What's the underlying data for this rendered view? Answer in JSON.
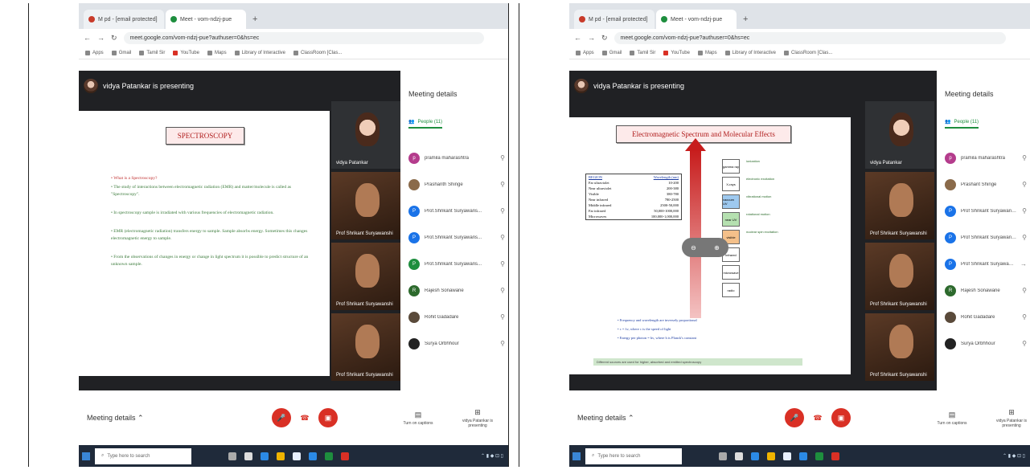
{
  "left": {
    "tabs": [
      "M pd - [email protected]",
      "Meet - vom-ndzj-pue"
    ],
    "url": "meet.google.com/vom-ndzj-pue?authuser=0&hs=ec",
    "bookmarks": [
      "Apps",
      "Gmail",
      "Tamil Sir",
      "YouTube",
      "Maps",
      "Library of Interactive",
      "ClassRoom [Clas..."
    ],
    "presenting": "vidya Patankar is presenting",
    "slide": {
      "title": "SPECTROSCOPY",
      "bullets": [
        "• What is a Spectroscopy?",
        "• The study of interactions between electromagnetic radiation (EMR) and matter/molecule is called as \"Spectroscopy\".",
        "• In spectroscopy sample is irradiated with various frequencies of electromagnetic radiation.",
        "• EMR (electromagnetic radiation) transfers energy to sample. Sample absorbs energy. Sometimes this changes electromagnetic energy to sample.",
        "• From the observations of changes in energy or change in light spectrum it is possible to predict structure of an unknown sample."
      ]
    },
    "tiles": [
      "vidya Patankar",
      "Prof Shrikant Suryawanshi",
      "Prof Shrikant Suryawanshi",
      "Prof Shrikant Suryawanshi"
    ],
    "side_title": "Meeting details",
    "side_tab": "People (11)",
    "people": [
      "pramila maharashtra",
      "Prashanth Shinge",
      "Prof.Shrikant Suryawans...",
      "Prof.Shrikant Suryawans...",
      "Prof.Shrikant Suryawans...",
      "Rajesh Sonawane",
      "Rohit Gadadare",
      "Surya Orbhhour"
    ],
    "meeting_details": "Meeting details",
    "captions": "Turn on captions",
    "present": "vidya Patankar is presenting",
    "search": "Type here to search"
  },
  "right": {
    "tabs": [
      "M pd - [email protected]",
      "Meet - vom-ndzj-pue"
    ],
    "url": "meet.google.com/vom-ndzj-pue?authuser=0&hs=ec",
    "bookmarks": [
      "Apps",
      "Gmail",
      "Tamil Sir",
      "YouTube",
      "Maps",
      "Library of Interactive",
      "ClassRoom [Clas..."
    ],
    "presenting": "vidya Patankar is presenting",
    "slide": {
      "title": "Electromagnetic Spectrum and Molecular Effects",
      "table": [
        [
          "REGION",
          "Wavelength (nm)"
        ],
        [
          "Far ultraviolet",
          "10-200"
        ],
        [
          "Near ultraviolet",
          "200-380"
        ],
        [
          "Visible",
          "380-780"
        ],
        [
          "Near infrared",
          "780-2500"
        ],
        [
          "Middle infrared",
          "2500-50,000"
        ],
        [
          "Far infrared",
          "50,000-1000,000"
        ],
        [
          "Microwaves",
          "100,000-1,000,000"
        ]
      ],
      "boxes": [
        "gamma ray",
        "X-rays",
        "vacuum UV",
        "near UV",
        "visible",
        "infrared",
        "microwave",
        "radio"
      ],
      "effects": [
        "ionization",
        "electronic excitation",
        "vibrational motion",
        "rotational motion",
        "nuclear spin excitation"
      ],
      "notes": [
        "• Frequency and wavelength are inversely proportional",
        "• c = λν, where c is the speed of light",
        "• Energy per photon = hν, where h is Planck's constant"
      ],
      "footer": "Different sources are used for higher, absorbed and emitted spectroscopy"
    },
    "tiles": [
      "vidya Patankar",
      "Prof Shrikant Suryawanshi",
      "Prof Shrikant Suryawanshi",
      "Prof Shrikant Suryawanshi"
    ],
    "side_title": "Meeting details",
    "side_tab": "People (11)",
    "people": [
      "pramila maharashtra",
      "Prashant Shinge",
      "Prof Shrikant Suryawans...",
      "Prof Shrikant Suryawans...",
      "Prof Shrikant Suryawans...",
      "Rajesh Sonawane",
      "Rohit Gadadare",
      "Surya Orbhhour"
    ],
    "meeting_details": "Meeting details",
    "captions": "Turn on captions",
    "present": "vidya Patankar is presenting",
    "search": "Type here to search"
  },
  "colors": {
    "red": "#d93025",
    "green": "#1e8e3e",
    "dark": "#202124"
  },
  "icons": [
    "mic-off-icon",
    "end-call-icon",
    "camera-off-icon",
    "captions-icon",
    "present-icon",
    "pin-icon",
    "windows-icon",
    "search-icon"
  ]
}
